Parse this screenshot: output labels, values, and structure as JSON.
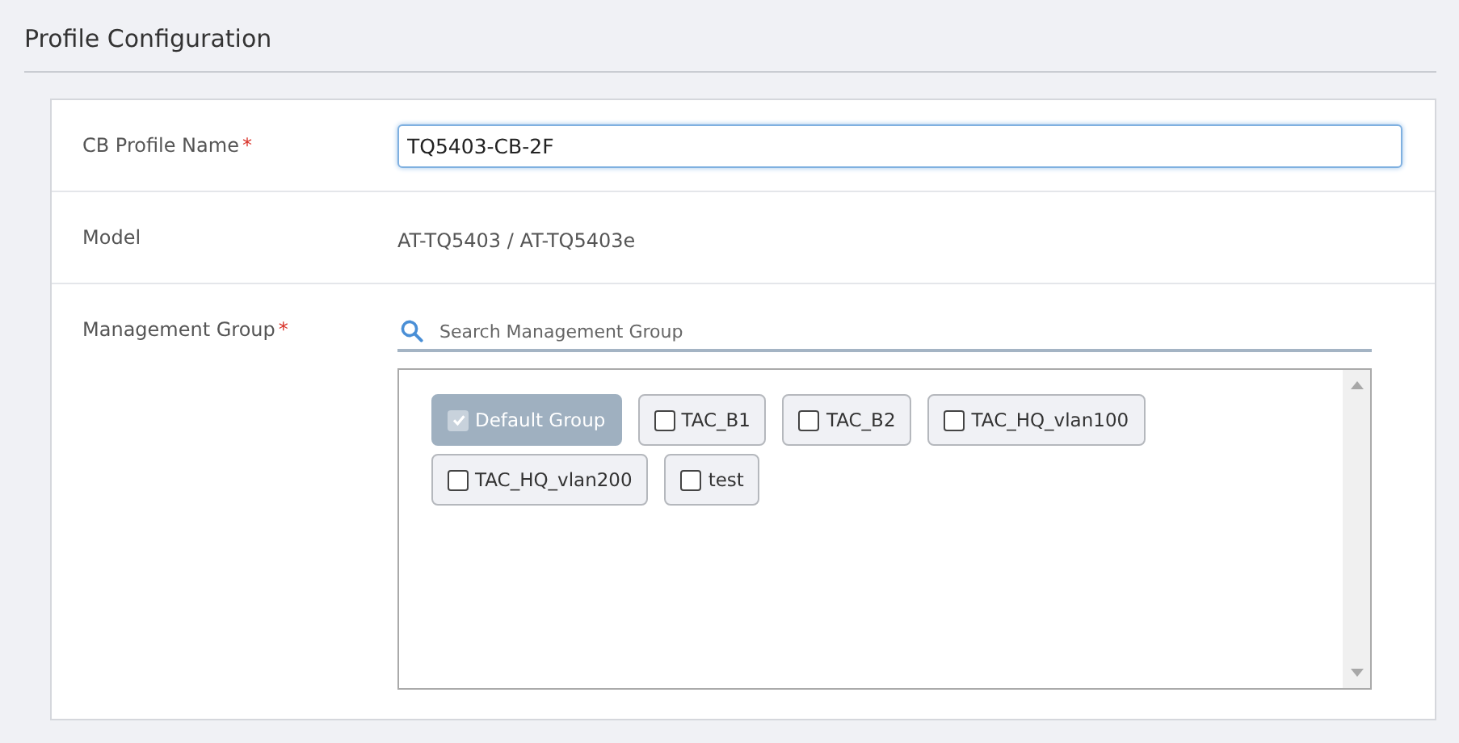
{
  "title": "Profile Configuration",
  "fields": [
    {
      "label": "CB Profile Name",
      "required_mark": "*",
      "kind": "input",
      "value": "TQ5403-CB-2F"
    },
    {
      "label": "Model",
      "kind": "text",
      "value": "AT-TQ5403 / AT-TQ5403e"
    },
    {
      "label": "Management Group",
      "required_mark": "*",
      "kind": "groups",
      "placeholder": "Search Management Group",
      "groups": [
        {
          "label": "Default Group",
          "checked": true,
          "disabled": true
        },
        {
          "label": "TAC_B1",
          "checked": false,
          "disabled": false
        },
        {
          "label": "TAC_B2",
          "checked": false,
          "disabled": false
        },
        {
          "label": "TAC_HQ_vlan100",
          "checked": false,
          "disabled": false
        },
        {
          "label": "TAC_HQ_vlan200",
          "checked": false,
          "disabled": false
        },
        {
          "label": "test",
          "checked": false,
          "disabled": false
        }
      ]
    }
  ]
}
